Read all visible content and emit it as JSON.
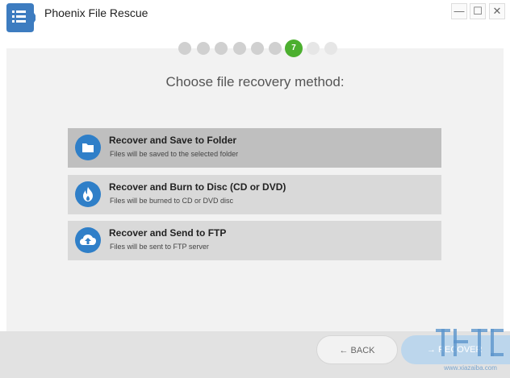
{
  "window": {
    "title": "Phoenix File Rescue",
    "controls": {
      "minimize": "—",
      "maximize": "☐",
      "close": "✕"
    }
  },
  "stepper": {
    "active_step_label": "7",
    "steps_completed": 6,
    "steps_total": 9
  },
  "heading": "Choose file recovery method:",
  "options": [
    {
      "title": "Recover and Save to Folder",
      "subtitle": "Files will be saved to the selected folder",
      "icon": "folder-icon",
      "selected": true
    },
    {
      "title": "Recover and Burn to Disc (CD or DVD)",
      "subtitle": "Files will be burned to CD or DVD disc",
      "icon": "flame-icon",
      "selected": false
    },
    {
      "title": "Recover and Send to FTP",
      "subtitle": "Files will be sent to FTP server",
      "icon": "cloud-upload-icon",
      "selected": false
    }
  ],
  "footer": {
    "back_label": "← BACK",
    "recover_label": "→ RECOVER"
  },
  "watermark": {
    "text": "www.xiazaiba.com"
  },
  "colors": {
    "accent": "#2f7fc8",
    "step_active": "#4caf2f",
    "selected_option": "#bfbfbf",
    "option": "#d9d9d9"
  }
}
